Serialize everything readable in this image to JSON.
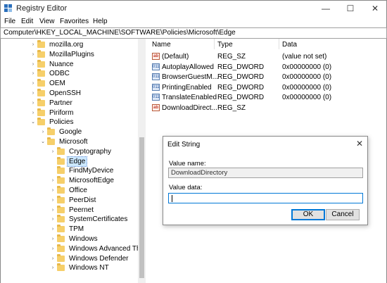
{
  "window": {
    "title": "Registry Editor",
    "minimize": "—",
    "maximize": "☐",
    "close": "✕"
  },
  "menu": [
    "File",
    "Edit",
    "View",
    "Favorites",
    "Help"
  ],
  "address": "Computer\\HKEY_LOCAL_MACHINE\\SOFTWARE\\Policies\\Microsoft\\Edge",
  "tree": [
    {
      "label": "mozilla.org",
      "depth": 0,
      "expanded": false
    },
    {
      "label": "MozillaPlugins",
      "depth": 0,
      "expanded": false
    },
    {
      "label": "Nuance",
      "depth": 0,
      "expanded": false
    },
    {
      "label": "ODBC",
      "depth": 0,
      "expanded": false
    },
    {
      "label": "OEM",
      "depth": 0,
      "expanded": false
    },
    {
      "label": "OpenSSH",
      "depth": 0,
      "expanded": false
    },
    {
      "label": "Partner",
      "depth": 0,
      "expanded": false
    },
    {
      "label": "Piriform",
      "depth": 0,
      "expanded": false
    },
    {
      "label": "Policies",
      "depth": 0,
      "expanded": true
    },
    {
      "label": "Google",
      "depth": 1,
      "expanded": false
    },
    {
      "label": "Microsoft",
      "depth": 1,
      "expanded": true
    },
    {
      "label": "Cryptography",
      "depth": 2,
      "expanded": false
    },
    {
      "label": "Edge",
      "depth": 2,
      "expanded": false,
      "selected": true,
      "nochev": true
    },
    {
      "label": "FindMyDevice",
      "depth": 2,
      "expanded": false,
      "nochev": true
    },
    {
      "label": "MicrosoftEdge",
      "depth": 2,
      "expanded": false
    },
    {
      "label": "Office",
      "depth": 2,
      "expanded": false
    },
    {
      "label": "PeerDist",
      "depth": 2,
      "expanded": false
    },
    {
      "label": "Peernet",
      "depth": 2,
      "expanded": false
    },
    {
      "label": "SystemCertificates",
      "depth": 2,
      "expanded": false
    },
    {
      "label": "TPM",
      "depth": 2,
      "expanded": false
    },
    {
      "label": "Windows",
      "depth": 2,
      "expanded": false
    },
    {
      "label": "Windows Advanced Thre",
      "depth": 2,
      "expanded": false
    },
    {
      "label": "Windows Defender",
      "depth": 2,
      "expanded": false
    },
    {
      "label": "Windows NT",
      "depth": 2,
      "expanded": false
    }
  ],
  "columns": {
    "name": "Name",
    "type": "Type",
    "data": "Data"
  },
  "values": [
    {
      "icon": "ab",
      "kind": "sz",
      "name": "(Default)",
      "type": "REG_SZ",
      "data": "(value not set)"
    },
    {
      "icon": "011",
      "kind": "dword",
      "name": "AutoplayAllowed",
      "type": "REG_DWORD",
      "data": "0x00000000 (0)"
    },
    {
      "icon": "011",
      "kind": "dword",
      "name": "BrowserGuestM...",
      "type": "REG_DWORD",
      "data": "0x00000000 (0)"
    },
    {
      "icon": "011",
      "kind": "dword",
      "name": "PrintingEnabled",
      "type": "REG_DWORD",
      "data": "0x00000000 (0)"
    },
    {
      "icon": "011",
      "kind": "dword",
      "name": "TranslateEnabled",
      "type": "REG_DWORD",
      "data": "0x00000000 (0)"
    },
    {
      "icon": "ab",
      "kind": "sz",
      "name": "DownloadDirect...",
      "type": "REG_SZ",
      "data": ""
    }
  ],
  "dialog": {
    "title": "Edit String",
    "close": "✕",
    "value_name_label": "Value name:",
    "value_name": "DownloadDirectory",
    "value_data_label": "Value data:",
    "value_data": "",
    "ok": "OK",
    "cancel": "Cancel"
  }
}
